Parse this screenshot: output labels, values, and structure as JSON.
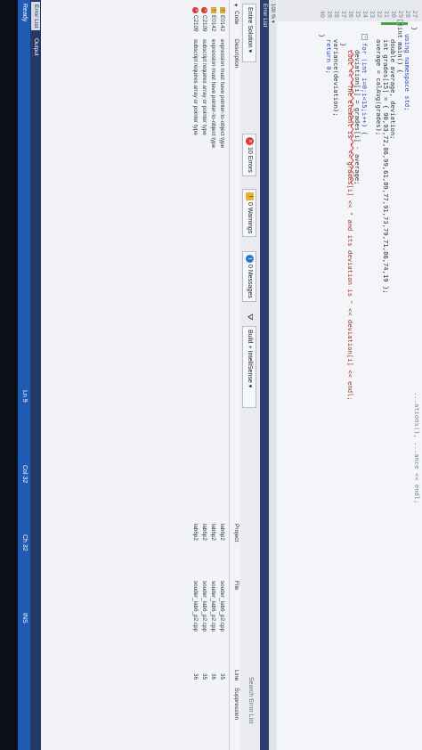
{
  "editor": {
    "lines": [
      {
        "n": "27",
        "text": "}"
      },
      {
        "n": "28",
        "text": "using namespace std;"
      },
      {
        "n": "29",
        "text": "int main() {"
      },
      {
        "n": "30",
        "text": "double average, deviation;"
      },
      {
        "n": "31",
        "text": "int grades[15] = { 90,93,72,86,99,61,89,77,91,73,79,71,86,74,19 };"
      },
      {
        "n": "32",
        "text": "average = calAvg(grades);"
      },
      {
        "n": "33",
        "text": ""
      },
      {
        "n": "34",
        "text": "for (int i=0;i<15;i++) {"
      },
      {
        "n": "35",
        "text": "deviation[i] = grades[i] - average;"
      },
      {
        "n": "36",
        "text": "cout << \"The element is \" << grades[i] << \" and its deviation is \" << deviation[i] << endl;"
      },
      {
        "n": "37",
        "text": "}"
      },
      {
        "n": "38",
        "text": "variance(deviation);"
      },
      {
        "n": "39",
        "text": "return 0;"
      },
      {
        "n": "40",
        "text": "}"
      }
    ],
    "top_fragment": "...ations(), ...ance << endl;"
  },
  "zoom": "100 %",
  "panel": {
    "title": "Error List",
    "scope": "Entire Solution",
    "errors_label": "10 Errors",
    "warnings_label": "0 Warnings",
    "messages_label": "0 Messages",
    "filter_label": "Build + IntelliSense",
    "search_label": "Search Error List",
    "columns": {
      "code": "Code",
      "description": "Description",
      "project": "Project",
      "file": "File",
      "line": "Line",
      "suppression": "Suppression"
    },
    "rows": [
      {
        "type": "warn",
        "code": "E0142",
        "description": "expression must have pointer-to-object type",
        "project": "lab6p2",
        "file": "souder_lab6_p2.cpp",
        "line": "35"
      },
      {
        "type": "warn",
        "code": "E0142",
        "description": "expression must have pointer-to-object type",
        "project": "lab6p2",
        "file": "souder_lab6_p2.cpp",
        "line": "36"
      },
      {
        "type": "err",
        "code": "C2109",
        "description": "subscript requires array or pointer type",
        "project": "lab6p2",
        "file": "souder_lab6_p2.cpp",
        "line": "35"
      },
      {
        "type": "err",
        "code": "C2109",
        "description": "subscript requires array or pointer type",
        "project": "lab6p2",
        "file": "souder_lab6_p2.cpp",
        "line": "36"
      }
    ]
  },
  "tabs": {
    "error_list": "Error List",
    "output": "Output"
  },
  "status": {
    "ready": "Ready",
    "ln": "Ln 9",
    "col": "Col 32",
    "ch": "Ch 32",
    "ins": "INS"
  },
  "colors": {
    "status_bar": "#1e5bb5",
    "tab_bar": "#263a69",
    "error_red": "#d83b32"
  }
}
